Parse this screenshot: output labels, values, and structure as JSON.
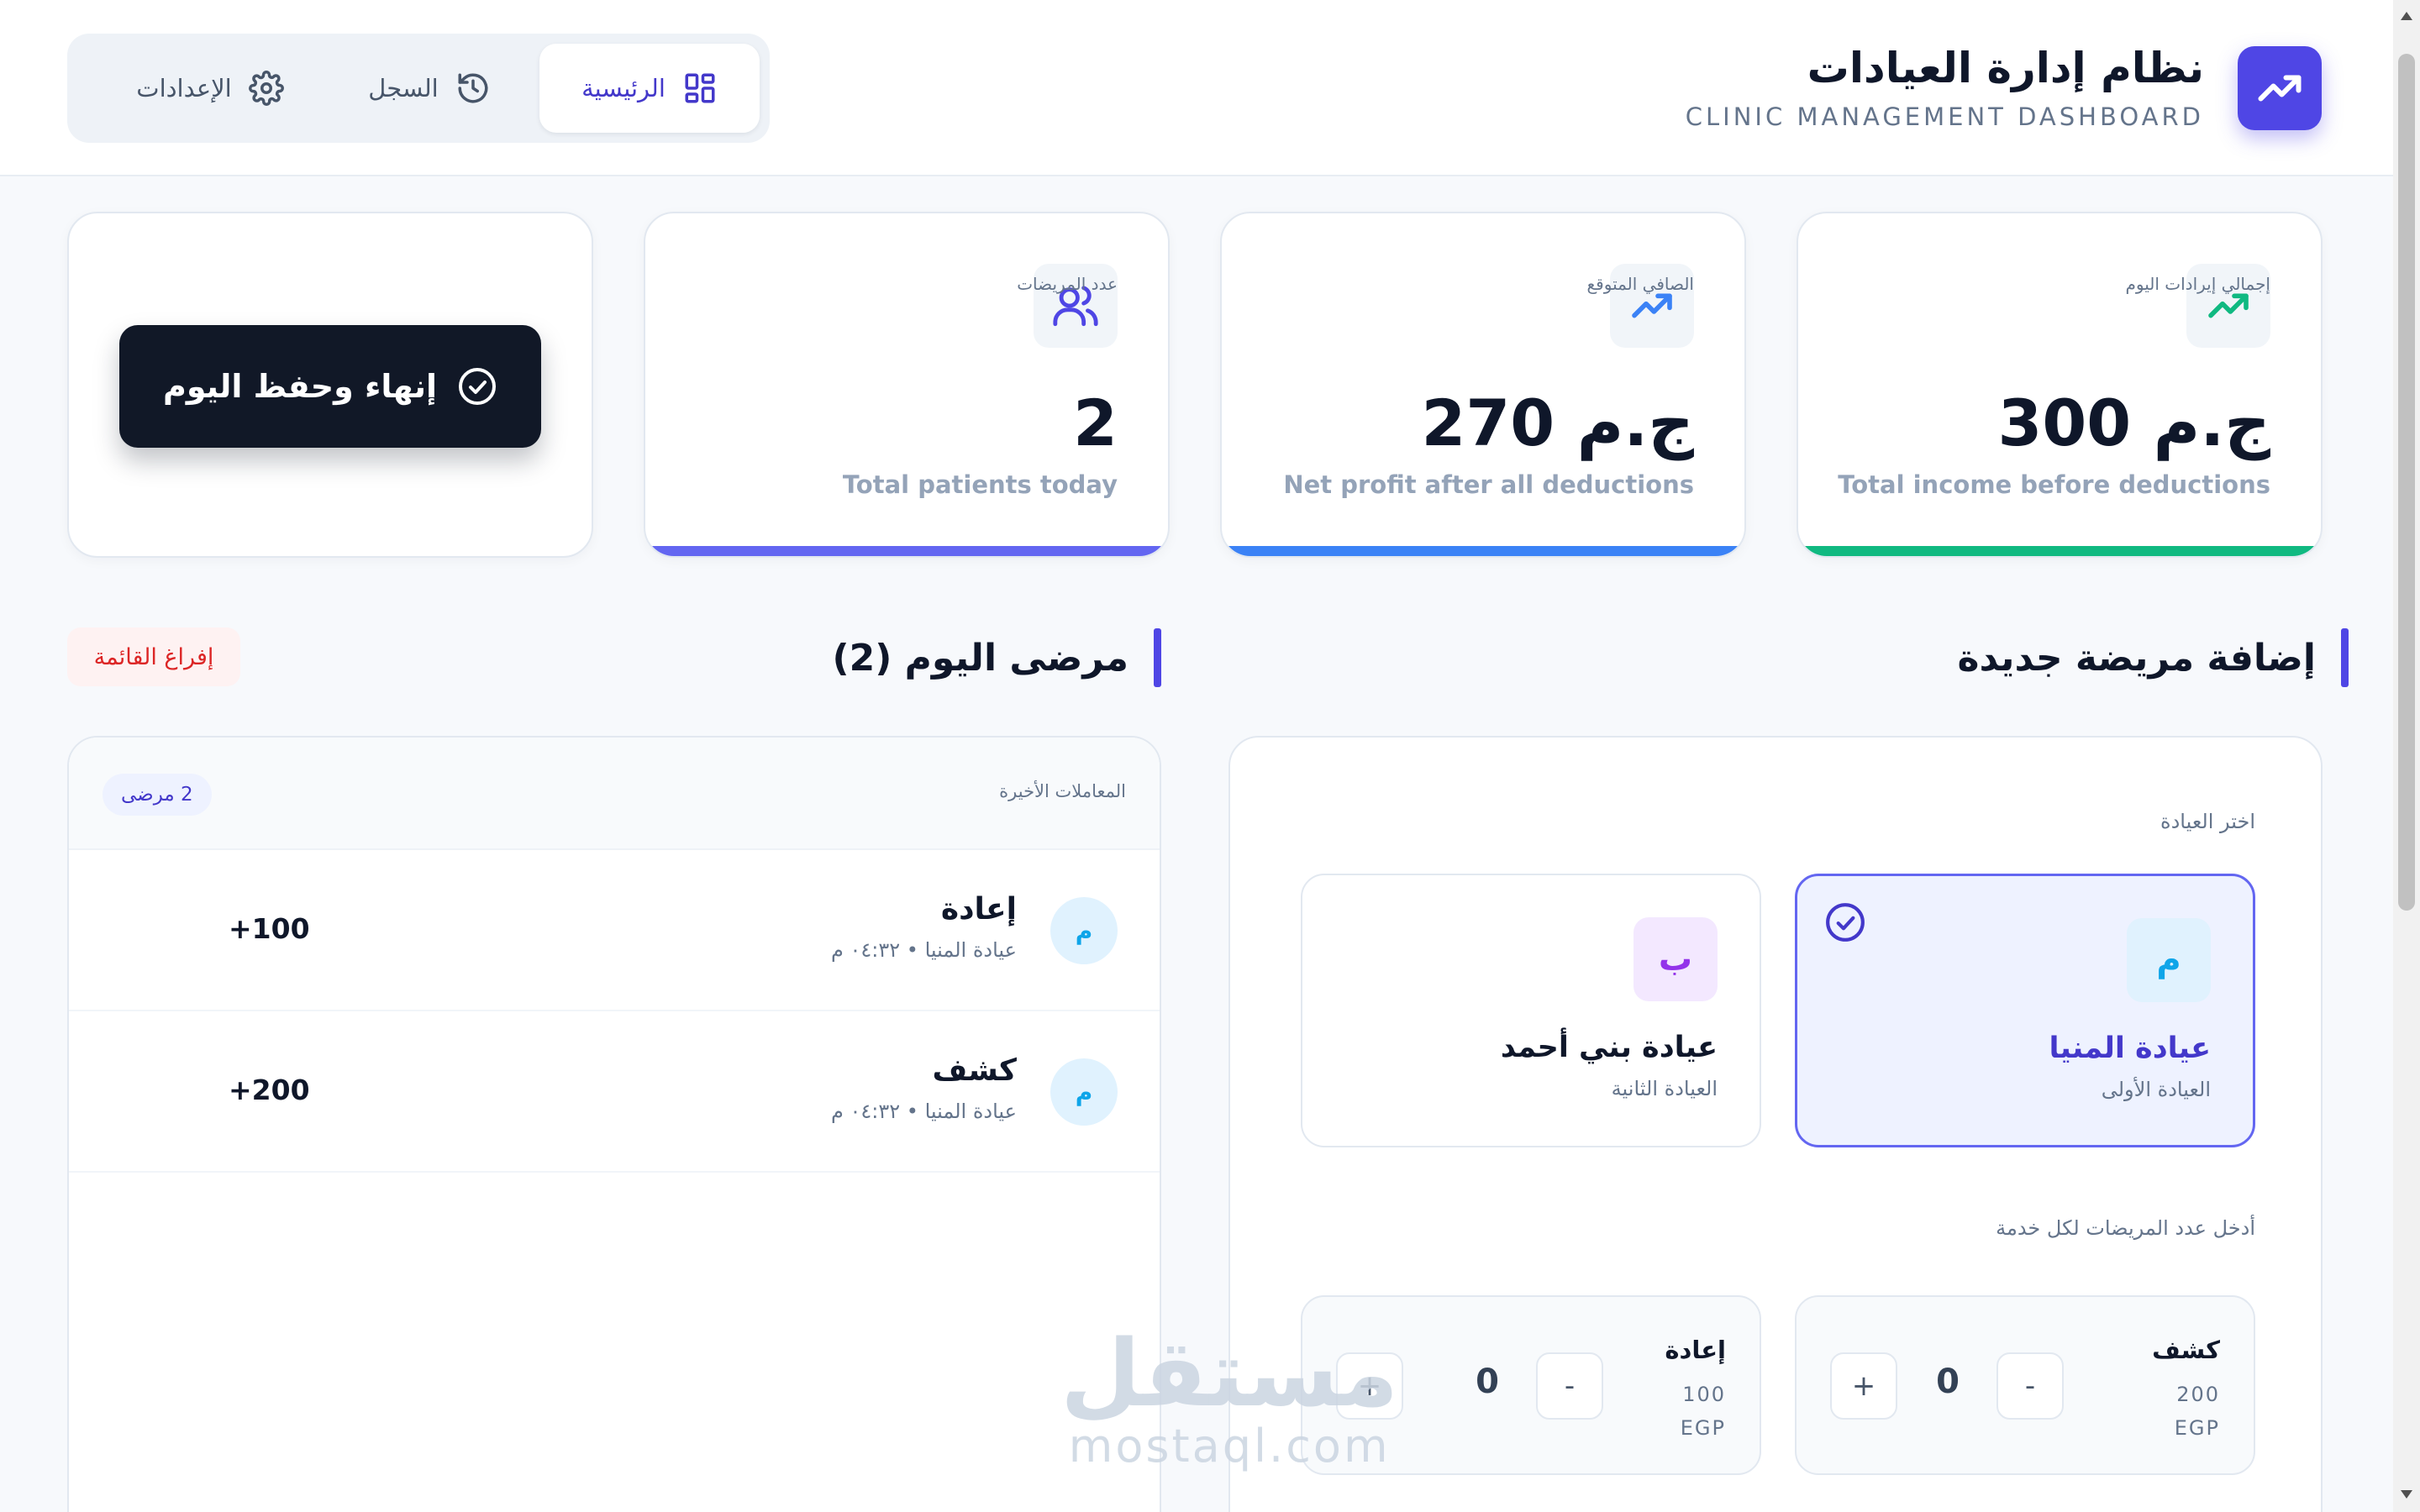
{
  "header": {
    "title": "نظام إدارة العيادات",
    "subtitle": "CLINIC MANAGEMENT DASHBOARD",
    "brand_icon": "trending-up-icon",
    "accent": "#4f46e5"
  },
  "nav": {
    "tabs": [
      {
        "label": "الرئيسية",
        "icon": "grid-icon",
        "active": true
      },
      {
        "label": "السجل",
        "icon": "history-icon",
        "active": false
      },
      {
        "label": "الإعدادات",
        "icon": "gear-icon",
        "active": false
      }
    ]
  },
  "stats": [
    {
      "label": "إجمالي إيرادات اليوم",
      "value": "300 ج.م",
      "caption": "Total income before deductions",
      "color": "#10b981",
      "icon": "trending-up-icon"
    },
    {
      "label": "الصافي المتوقع",
      "value": "270 ج.م",
      "caption": "Net profit after all deductions",
      "color": "#3b82f6",
      "icon": "trending-up-icon"
    },
    {
      "label": "عدد المريضات",
      "value": "2",
      "caption": "Total patients today",
      "color": "#6366f1",
      "icon": "users-icon"
    }
  ],
  "finish_button": "إنهاء وحفظ اليوم",
  "add_section": {
    "title": "إضافة مريضة جديدة",
    "choose_clinic_label": "اختر العيادة",
    "clinics": [
      {
        "letter": "م",
        "name": "عيادة المنيا",
        "sub": "العيادة الأولى",
        "selected": true
      },
      {
        "letter": "ب",
        "name": "عيادة بني أحمد",
        "sub": "العيادة الثانية",
        "selected": false
      }
    ],
    "count_label": "أدخل عدد المريضات لكل خدمة",
    "services": [
      {
        "name": "كشف",
        "price": "200",
        "currency": "EGP",
        "count": "0",
        "minus": "-",
        "plus": "+"
      },
      {
        "name": "إعادة",
        "price": "100",
        "currency": "EGP",
        "count": "0",
        "minus": "-",
        "plus": "+"
      }
    ]
  },
  "patients_section": {
    "title": "مرضى اليوم (2)",
    "clear_button": "إفراغ القائمة",
    "recent_label": "المعاملات الأخيرة",
    "count_pill": "2 مرضى",
    "rows": [
      {
        "avatar": "م",
        "service": "إعادة",
        "meta": "عيادة المنيا • ٠٤:٣٢ م",
        "amount": "+100"
      },
      {
        "avatar": "م",
        "service": "كشف",
        "meta": "عيادة المنيا • ٠٤:٣٢ م",
        "amount": "+200"
      }
    ]
  },
  "watermark": {
    "arabic": "مستقل",
    "latin": "mostaql.com"
  }
}
